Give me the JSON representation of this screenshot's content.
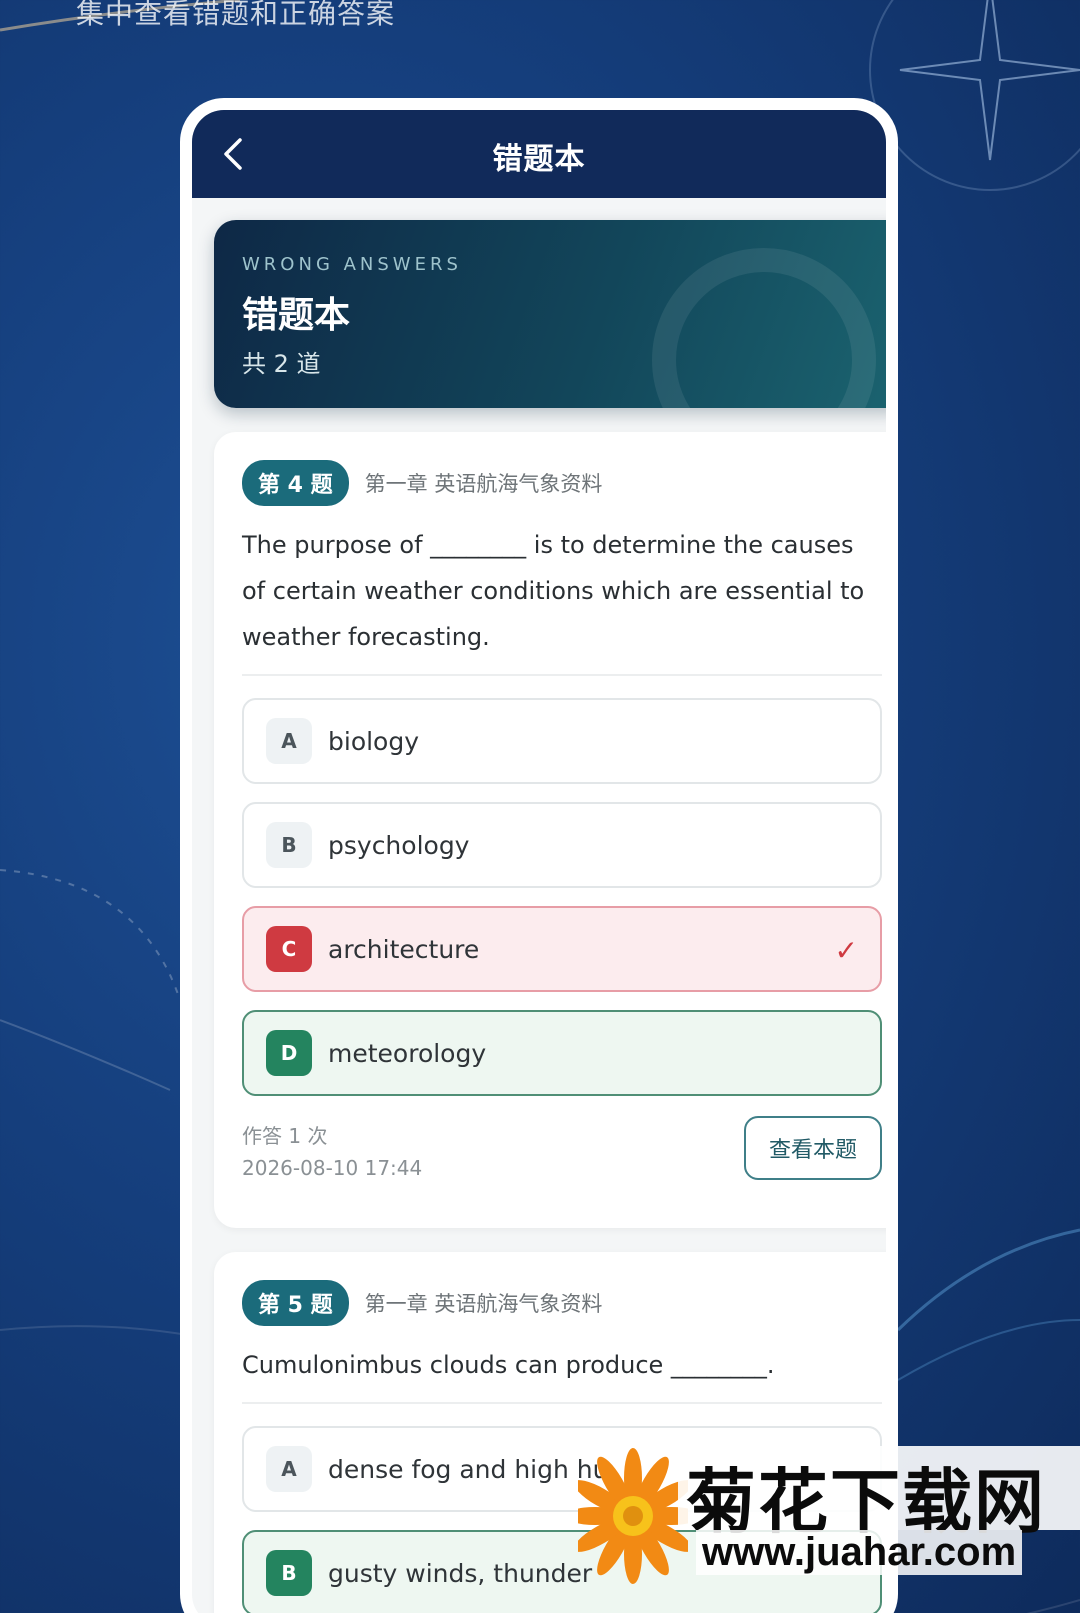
{
  "promo": {
    "caption": "集中查看错题和正确答案"
  },
  "nav": {
    "title": "错题本",
    "back_icon": "chevron-left-icon"
  },
  "hero": {
    "eyebrow": "WRONG ANSWERS",
    "title": "错题本",
    "count": "共 2 道"
  },
  "questions": [
    {
      "badge": "第 4 题",
      "chapter": "第一章 英语航海气象资料",
      "text": "The purpose of ________ is to determine the causes of certain weather conditions which are essential to weather forecasting.",
      "options": [
        {
          "letter": "A",
          "text": "biology",
          "state": "normal"
        },
        {
          "letter": "B",
          "text": "psychology",
          "state": "normal"
        },
        {
          "letter": "C",
          "text": "architecture",
          "state": "wrong",
          "mark": "✓"
        },
        {
          "letter": "D",
          "text": "meteorology",
          "state": "correct"
        }
      ],
      "attempts": "作答 1 次",
      "time": "2026-08-10 17:44",
      "view_label": "查看本题"
    },
    {
      "badge": "第 5 题",
      "chapter": "第一章 英语航海气象资料",
      "text": "Cumulonimbus clouds can produce ________.",
      "options": [
        {
          "letter": "A",
          "text": "dense fog and high hu",
          "state": "normal"
        },
        {
          "letter": "B",
          "text": "gusty winds, thunder",
          "state": "correct"
        }
      ]
    }
  ],
  "watermark": {
    "title": "菊花下载网",
    "url": "www.juahar.com"
  },
  "colors": {
    "nav": "#112a5a",
    "accent": "#1b6b7b",
    "wrong": "#cf3a41",
    "correct": "#24845f"
  }
}
